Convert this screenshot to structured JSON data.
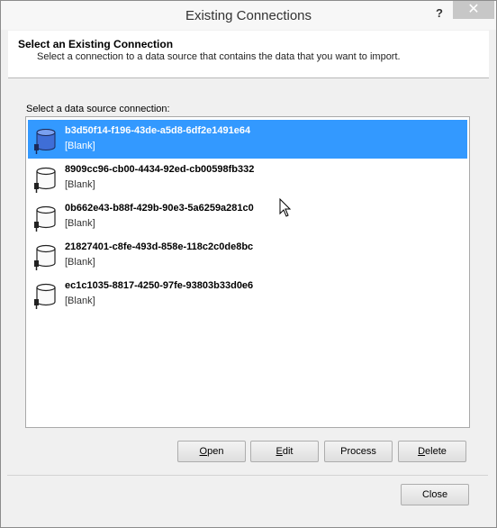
{
  "window": {
    "title": "Existing Connections",
    "help_label": "?",
    "close_label": "✕"
  },
  "header": {
    "title": "Select an Existing Connection",
    "description": "Select a connection to a data source that contains the data that you want to import."
  },
  "list": {
    "label": "Select a data source connection:",
    "items": [
      {
        "name": "b3d50f14-f196-43de-a5d8-6df2e1491e64",
        "subtitle": "[Blank]",
        "selected": true
      },
      {
        "name": "8909cc96-cb00-4434-92ed-cb00598fb332",
        "subtitle": "[Blank]",
        "selected": false
      },
      {
        "name": "0b662e43-b88f-429b-90e3-5a6259a281c0",
        "subtitle": "[Blank]",
        "selected": false
      },
      {
        "name": "21827401-c8fe-493d-858e-118c2c0de8bc",
        "subtitle": "[Blank]",
        "selected": false
      },
      {
        "name": "ec1c1035-8817-4250-97fe-93803b33d0e6",
        "subtitle": "[Blank]",
        "selected": false
      }
    ]
  },
  "buttons": {
    "open": {
      "first": "O",
      "rest": "pen"
    },
    "edit": {
      "first": "E",
      "rest": "dit"
    },
    "process": "Process",
    "delete": {
      "first": "D",
      "rest": "elete"
    },
    "close": "Close"
  },
  "colors": {
    "selection": "#3399ff",
    "selected_icon": "#3f6ed6"
  },
  "icons": {
    "item_icon": "database-icon",
    "cursor": "mouse-pointer-icon"
  }
}
